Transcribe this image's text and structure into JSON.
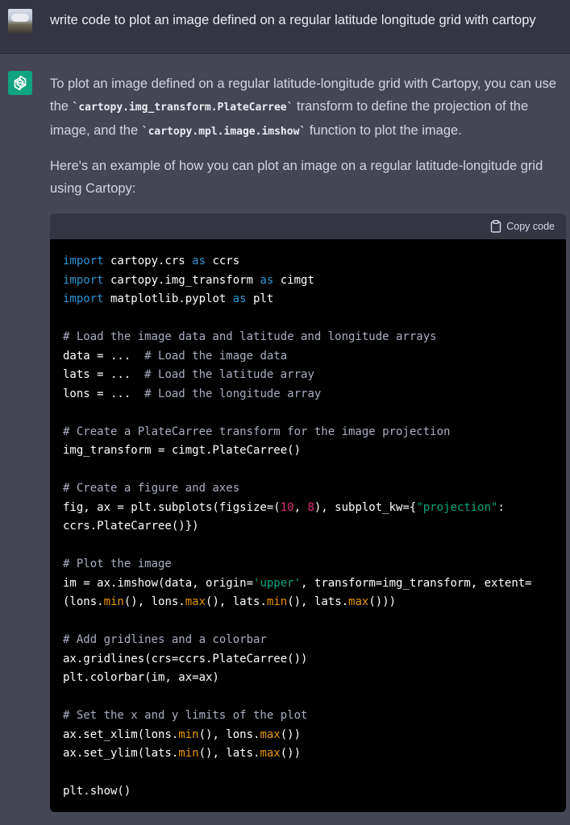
{
  "user_message": {
    "text": "write code to plot an image defined on a regular latitude longitude grid with cartopy"
  },
  "assistant_message": {
    "intro_1": "To plot an image defined on a regular latitude-longitude grid with Cartopy, you can use the ",
    "code_1": "`cartopy.img_transform.PlateCarree`",
    "intro_2": " transform to define the projection of the image, and the ",
    "code_2": "`cartopy.mpl.image.imshow`",
    "intro_3": " function to plot the image.",
    "paragraph_2": "Here's an example of how you can plot an image on a regular latitude-longitude grid using Cartopy:"
  },
  "code_block": {
    "copy_label": "Copy code",
    "lines": [
      [
        {
          "t": "kw",
          "v": "import"
        },
        {
          "t": "pl",
          "v": " cartopy.crs "
        },
        {
          "t": "kw",
          "v": "as"
        },
        {
          "t": "pl",
          "v": " ccrs"
        }
      ],
      [
        {
          "t": "kw",
          "v": "import"
        },
        {
          "t": "pl",
          "v": " cartopy.img_transform "
        },
        {
          "t": "kw",
          "v": "as"
        },
        {
          "t": "pl",
          "v": " cimgt"
        }
      ],
      [
        {
          "t": "kw",
          "v": "import"
        },
        {
          "t": "pl",
          "v": " matplotlib.pyplot "
        },
        {
          "t": "kw",
          "v": "as"
        },
        {
          "t": "pl",
          "v": " plt"
        }
      ],
      [],
      [
        {
          "t": "cm",
          "v": "# Load the image data and latitude and longitude arrays"
        }
      ],
      [
        {
          "t": "pl",
          "v": "data = ...  "
        },
        {
          "t": "cm",
          "v": "# Load the image data"
        }
      ],
      [
        {
          "t": "pl",
          "v": "lats = ...  "
        },
        {
          "t": "cm",
          "v": "# Load the latitude array"
        }
      ],
      [
        {
          "t": "pl",
          "v": "lons = ...  "
        },
        {
          "t": "cm",
          "v": "# Load the longitude array"
        }
      ],
      [],
      [
        {
          "t": "cm",
          "v": "# Create a PlateCarree transform for the image projection"
        }
      ],
      [
        {
          "t": "pl",
          "v": "img_transform = cimgt.PlateCarree()"
        }
      ],
      [],
      [
        {
          "t": "cm",
          "v": "# Create a figure and axes"
        }
      ],
      [
        {
          "t": "pl",
          "v": "fig, ax = plt.subplots(figsize=("
        },
        {
          "t": "num",
          "v": "10"
        },
        {
          "t": "pl",
          "v": ", "
        },
        {
          "t": "num",
          "v": "8"
        },
        {
          "t": "pl",
          "v": "), subplot_kw={"
        },
        {
          "t": "str",
          "v": "\"projection\""
        },
        {
          "t": "pl",
          "v": ":"
        }
      ],
      [
        {
          "t": "pl",
          "v": "ccrs.PlateCarree()})"
        }
      ],
      [],
      [
        {
          "t": "cm",
          "v": "# Plot the image"
        }
      ],
      [
        {
          "t": "pl",
          "v": "im = ax.imshow(data, origin="
        },
        {
          "t": "str",
          "v": "'upper'"
        },
        {
          "t": "pl",
          "v": ", transform=img_transform, extent="
        }
      ],
      [
        {
          "t": "pl",
          "v": "(lons."
        },
        {
          "t": "fn",
          "v": "min"
        },
        {
          "t": "pl",
          "v": "(), lons."
        },
        {
          "t": "fn",
          "v": "max"
        },
        {
          "t": "pl",
          "v": "(), lats."
        },
        {
          "t": "fn",
          "v": "min"
        },
        {
          "t": "pl",
          "v": "(), lats."
        },
        {
          "t": "fn",
          "v": "max"
        },
        {
          "t": "pl",
          "v": "()))"
        }
      ],
      [],
      [
        {
          "t": "cm",
          "v": "# Add gridlines and a colorbar"
        }
      ],
      [
        {
          "t": "pl",
          "v": "ax.gridlines(crs=ccrs.PlateCarree())"
        }
      ],
      [
        {
          "t": "pl",
          "v": "plt.colorbar(im, ax=ax)"
        }
      ],
      [],
      [
        {
          "t": "cm",
          "v": "# Set the x and y limits of the plot"
        }
      ],
      [
        {
          "t": "pl",
          "v": "ax.set_xlim(lons."
        },
        {
          "t": "fn",
          "v": "min"
        },
        {
          "t": "pl",
          "v": "(), lons."
        },
        {
          "t": "fn",
          "v": "max"
        },
        {
          "t": "pl",
          "v": "())"
        }
      ],
      [
        {
          "t": "pl",
          "v": "ax.set_ylim(lats."
        },
        {
          "t": "fn",
          "v": "min"
        },
        {
          "t": "pl",
          "v": "(), lats."
        },
        {
          "t": "fn",
          "v": "max"
        },
        {
          "t": "pl",
          "v": "())"
        }
      ],
      [],
      [
        {
          "t": "pl",
          "v": "plt.show()"
        }
      ]
    ]
  },
  "icons": {
    "user_avatar": "user-photo-avatar",
    "assistant_avatar": "openai-logo-icon",
    "copy": "clipboard-icon"
  },
  "colors": {
    "user_bg": "#343541",
    "assistant_bg": "#444654",
    "assistant_avatar_bg": "#10a37f",
    "code_bg": "#000000",
    "keyword": "#2e95d3",
    "comment": "#a9aec1",
    "number": "#df3079",
    "string": "#00a67d",
    "builtin": "#e9950c"
  }
}
